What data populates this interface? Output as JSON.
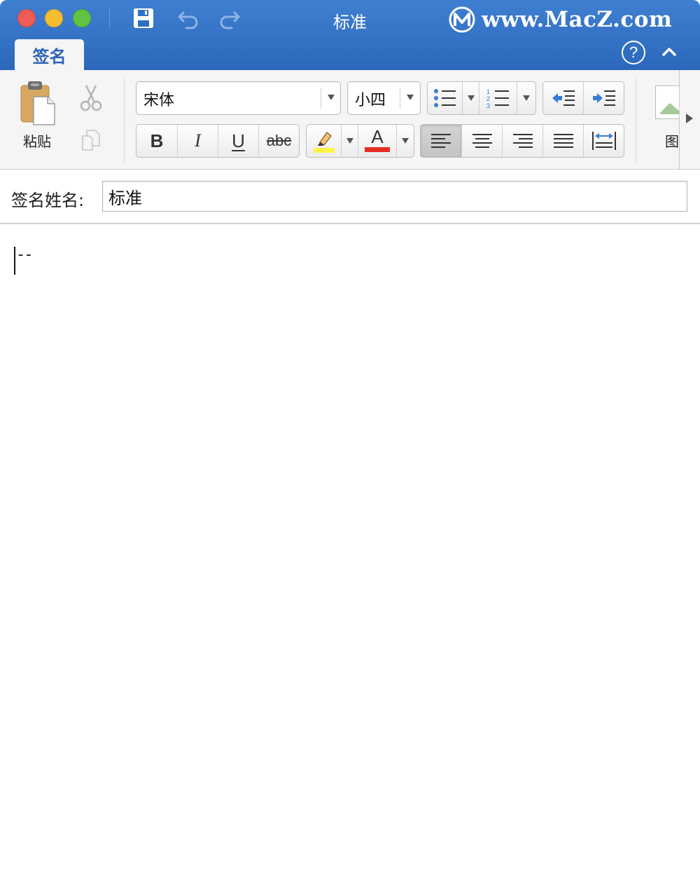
{
  "window": {
    "title": "标准",
    "watermark": "www.MacZ.com"
  },
  "tabs": [
    {
      "label": "签名",
      "active": true
    }
  ],
  "toolbar": {
    "help_label": "?",
    "paste_label": "粘贴",
    "font_name": "宋体",
    "font_size": "小四",
    "bold_label": "B",
    "italic_label": "I",
    "underline_label": "U",
    "strike_label": "abc",
    "font_color_label": "A",
    "picture_label": "图",
    "highlight_color": "#fff24a",
    "font_color": "#e52d26",
    "active_alignment": "left"
  },
  "signature": {
    "name_label": "签名姓名:",
    "name_value": "标准"
  },
  "editor": {
    "content": "--"
  },
  "colors": {
    "titlebar_blue": "#2f6ec4",
    "accent_blue": "#2b64b8"
  }
}
